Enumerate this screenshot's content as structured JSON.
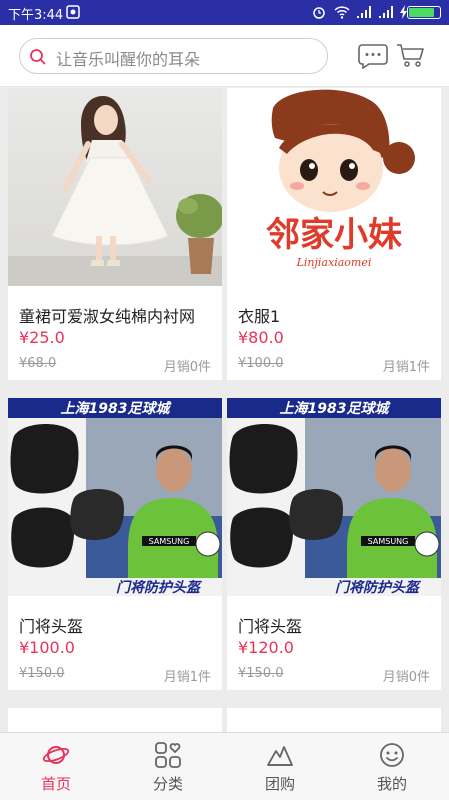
{
  "status": {
    "time": "下午3:44"
  },
  "search": {
    "placeholder": "让音乐叫醒你的耳朵"
  },
  "products": [
    {
      "title": "童裙可爱淑女纯棉内衬网",
      "price": "¥25.0",
      "old_price": "¥68.0",
      "sales": "月销0件"
    },
    {
      "title": "衣服1",
      "price": "¥80.0",
      "old_price": "¥100.0",
      "sales": "月销1件"
    },
    {
      "title": "门将头盔",
      "price": "¥100.0",
      "old_price": "¥150.0",
      "sales": "月销1件"
    },
    {
      "title": "门将头盔",
      "price": "¥120.0",
      "old_price": "¥150.0",
      "sales": "月销0件"
    }
  ],
  "images": {
    "logo_text": "邻家小妹",
    "logo_sub": "Linjiaxiaomei",
    "banner_text": "上海1983足球城",
    "helmet_caption": "门将防护头盔",
    "jersey_text": "SAMSUNG"
  },
  "tabs": [
    {
      "label": "首页",
      "icon": "planet-icon",
      "active": true
    },
    {
      "label": "分类",
      "icon": "grid-heart-icon",
      "active": false
    },
    {
      "label": "团购",
      "icon": "mountain-icon",
      "active": false
    },
    {
      "label": "我的",
      "icon": "smiley-icon",
      "active": false
    }
  ],
  "colors": {
    "accent": "#e8335a",
    "statusbar": "#2b2fa6"
  }
}
